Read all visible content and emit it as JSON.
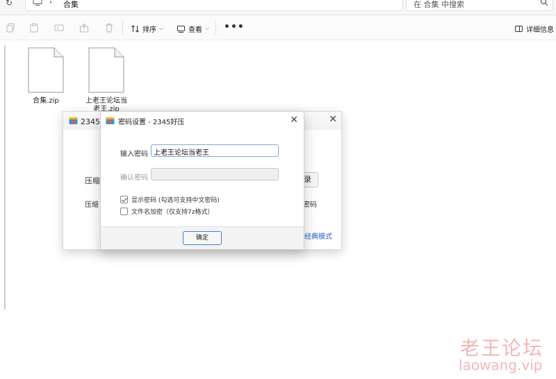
{
  "address_bar": {
    "path_folder": "合集",
    "search_placeholder": "在 合集 中搜索"
  },
  "toolbar": {
    "sort_label": "排序",
    "view_label": "查看",
    "details_label": "详细信息"
  },
  "files": [
    {
      "name": "合集.zip"
    },
    {
      "name": "上老王论坛当老王.zip"
    }
  ],
  "back_dialog": {
    "title": "2345好",
    "row1_label": "压缩",
    "row2_label": "压缩",
    "browse_button": "录",
    "password_fragment": "密码",
    "classic_mode_link": "经典模式"
  },
  "password_dialog": {
    "title": "密码设置 - 2345好压",
    "enter_label": "输入密码",
    "enter_value": "上老王论坛当老王",
    "confirm_label": "确认密码",
    "confirm_value": "",
    "show_password_label": "显示密码 (勾选可支持中文密码)",
    "show_password_checked": true,
    "encrypt_filename_label": "文件名加密（仅支持7z格式）",
    "encrypt_filename_checked": false,
    "ok_button": "确定"
  },
  "watermark": {
    "cn": "老王论坛",
    "en": "laowang.vip"
  },
  "colors": {
    "accent": "#3d7fd6",
    "link": "#2a62c9",
    "watermark": "#f3b7b7"
  }
}
